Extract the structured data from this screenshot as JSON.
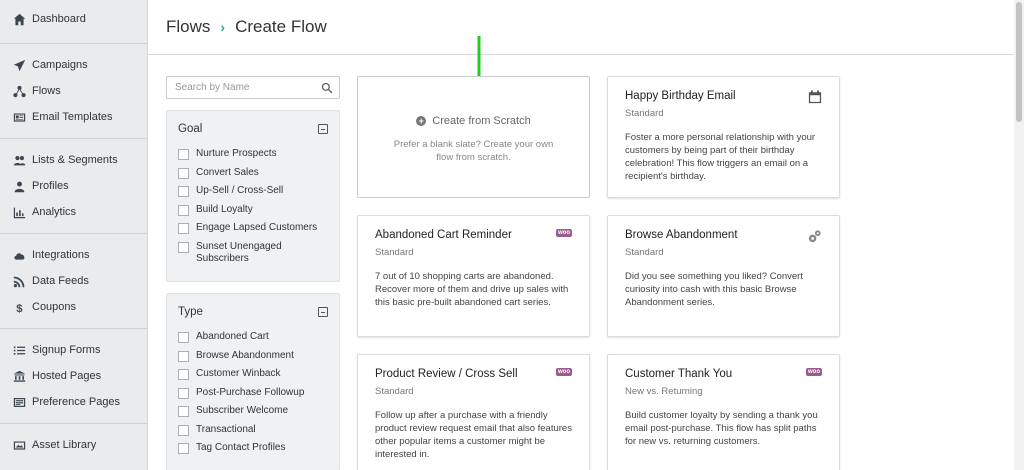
{
  "sidebar": {
    "items": [
      {
        "label": "Dashboard",
        "icon": "home-icon"
      },
      {
        "label": "Campaigns",
        "icon": "paper-plane-icon"
      },
      {
        "label": "Flows",
        "icon": "flows-icon"
      },
      {
        "label": "Email Templates",
        "icon": "email-template-icon"
      },
      {
        "label": "Lists & Segments",
        "icon": "users-icon"
      },
      {
        "label": "Profiles",
        "icon": "profile-icon"
      },
      {
        "label": "Analytics",
        "icon": "bar-chart-icon"
      },
      {
        "label": "Integrations",
        "icon": "cloud-icon"
      },
      {
        "label": "Data Feeds",
        "icon": "rss-icon"
      },
      {
        "label": "Coupons",
        "icon": "dollar-icon"
      },
      {
        "label": "Signup Forms",
        "icon": "list-icon"
      },
      {
        "label": "Hosted Pages",
        "icon": "bank-icon"
      },
      {
        "label": "Preference Pages",
        "icon": "preference-icon"
      },
      {
        "label": "Asset Library",
        "icon": "image-icon"
      }
    ]
  },
  "header": {
    "crumb_root": "Flows",
    "separator": "›",
    "crumb_current": "Create Flow"
  },
  "search": {
    "placeholder": "Search by Name"
  },
  "filters": {
    "goal": {
      "title": "Goal",
      "options": [
        "Nurture Prospects",
        "Convert Sales",
        "Up-Sell / Cross-Sell",
        "Build Loyalty",
        "Engage Lapsed Customers",
        "Sunset Unengaged Subscribers"
      ]
    },
    "type": {
      "title": "Type",
      "options": [
        "Abandoned Cart",
        "Browse Abandonment",
        "Customer Winback",
        "Post-Purchase Followup",
        "Subscriber Welcome",
        "Transactional",
        "Tag Contact Profiles"
      ]
    }
  },
  "scratch": {
    "title": "Create from Scratch",
    "description_line1": "Prefer a blank slate? Create your own",
    "description_line2": "flow from scratch."
  },
  "cards": [
    {
      "title": "Happy Birthday Email",
      "sub": "Standard",
      "icon": "calendar-icon",
      "desc": "Foster a more personal relationship with your customers by being part of their birthday celebration! This flow triggers an email on a recipient's birthday."
    },
    {
      "title": "Abandoned Cart Reminder",
      "sub": "Standard",
      "icon": "woo",
      "badge": "woo",
      "desc": "7 out of 10 shopping carts are abandoned. Recover more of them and drive up sales with this basic pre-built abandoned cart series."
    },
    {
      "title": "Browse Abandonment",
      "sub": "Standard",
      "icon": "gears-icon",
      "desc": "Did you see something you liked? Convert curiosity into cash with this basic Browse Abandonment series."
    },
    {
      "title": "Product Review / Cross Sell",
      "sub": "Standard",
      "icon": "woo",
      "badge": "woo",
      "desc": "Follow up after a purchase with a friendly product review request email that also features other popular items a customer might be interested in."
    },
    {
      "title": "Customer Thank You",
      "sub": "New vs. Returning",
      "icon": "woo",
      "badge": "woo",
      "desc": "Build customer loyalty by sending a thank you email post-purchase. This flow has split paths for new vs. returning customers."
    }
  ],
  "colors": {
    "accent_green": "#2db36e",
    "arrow_green": "#22cc22",
    "woo_purple": "#9b5c8f",
    "sidebar_bg": "#e9ebed"
  }
}
